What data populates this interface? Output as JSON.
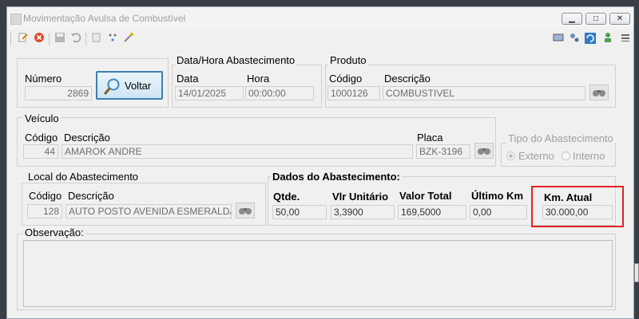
{
  "window": {
    "title": "Movimentação Avulsa de Combustível"
  },
  "toolbar": {
    "left_icons": [
      "edit-icon",
      "cancel-icon",
      "save-icon",
      "undo-icon",
      "copy-icon",
      "move-icon",
      "magic-icon"
    ],
    "right_icons": [
      "report-icon",
      "settings-icon",
      "refresh-icon",
      "user-icon",
      "menu-icon"
    ]
  },
  "numero": {
    "label": "Número",
    "value": "2869"
  },
  "voltar": {
    "label": "Voltar"
  },
  "data_hora": {
    "title": "Data/Hora Abastecimento",
    "data_label": "Data",
    "data_value": "14/01/2025",
    "hora_label": "Hora",
    "hora_value": "00:00:00"
  },
  "produto": {
    "title": "Produto",
    "codigo_label": "Código",
    "codigo_value": "1000126",
    "descricao_label": "Descrição",
    "descricao_value": "COMBUSTIVEL"
  },
  "veiculo": {
    "title": "Veículo",
    "codigo_label": "Código",
    "codigo_value": "44",
    "descricao_label": "Descrição",
    "descricao_value": "AMAROK ANDRE",
    "placa_label": "Placa",
    "placa_value": "BZK-3196"
  },
  "tipo": {
    "title": "Tipo do Abastecimento",
    "externo": "Externo",
    "interno": "Interno"
  },
  "local": {
    "title": "Local do Abastecimento",
    "codigo_label": "Código",
    "codigo_value": "128",
    "descricao_label": "Descrição",
    "descricao_value": "AUTO POSTO AVENIDA ESMERALDA"
  },
  "dados": {
    "title": "Dados do Abastecimento:",
    "qtde_label": "Qtde.",
    "qtde_value": "50,00",
    "vlr_label": "Vlr Unitário",
    "vlr_value": "3,3900",
    "total_label": "Valor Total",
    "total_value": "169,5000",
    "ultimo_label": "Último Km",
    "ultimo_value": "0,00",
    "km_label": "Km. Atual",
    "km_value": "30.000,00"
  },
  "observacao": {
    "label": "Observação:"
  },
  "colors": {
    "highlight": "#e32222",
    "button_border": "#3c7fb1"
  }
}
